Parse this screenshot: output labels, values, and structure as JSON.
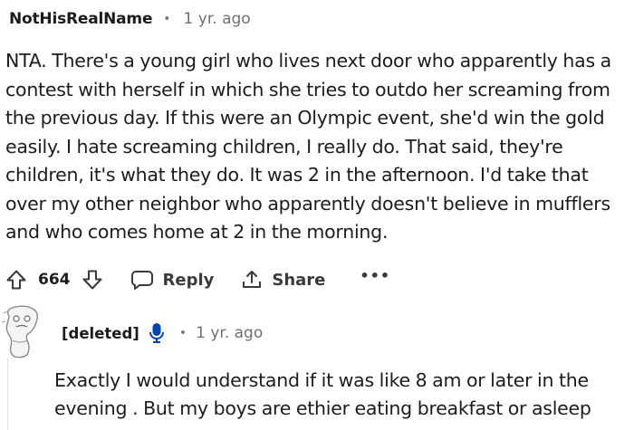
{
  "comment": {
    "username": "NotHisRealName",
    "separator": "•",
    "timestamp": "1 yr. ago",
    "body": "NTA. There's a young girl who lives next door who apparently has a contest with herself in which she tries to outdo her screaming from the previous day. If this were an Olympic event, she'd win the gold easily. I hate screaming children, I really do. That said, they're children, it's what they do. It was 2 in the afternoon. I'd take that over my other neighbor who apparently doesn't believe in mufflers and who comes home at 2 in the morning.",
    "votes": "664",
    "reply_label": "Reply",
    "share_label": "Share",
    "more_label": "•••",
    "icons": {
      "upvote": "upvote-arrow-icon",
      "downvote": "downvote-arrow-icon",
      "reply": "speech-bubble-icon",
      "share": "share-upload-icon"
    }
  },
  "reply": {
    "username": "[deleted]",
    "separator": "•",
    "timestamp": "1 yr. ago",
    "body": "Exactly I would understand if it was like 8 am or later in the evening . But my boys are ethier eating breakfast or asleep",
    "icons": {
      "avatar": "deleted-user-avatar-icon",
      "badge": "microphone-icon"
    },
    "badge_color": "#0045ac"
  }
}
